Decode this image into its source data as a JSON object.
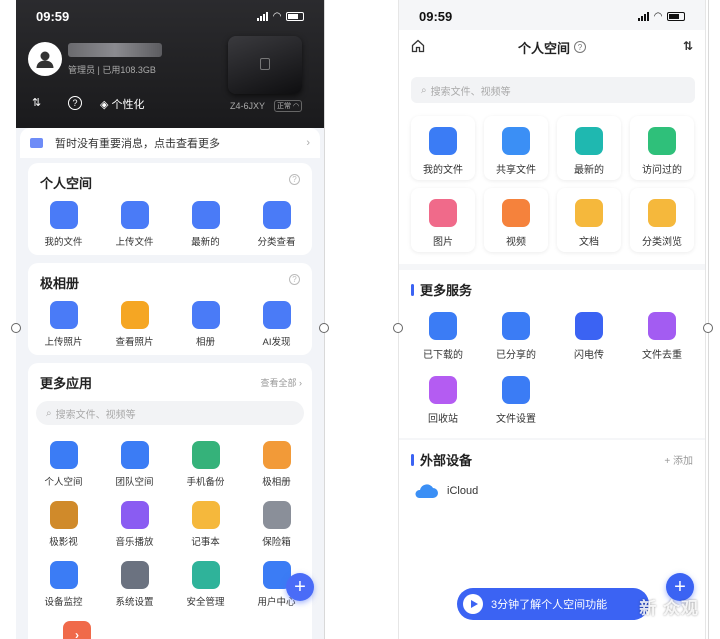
{
  "left": {
    "status": {
      "time": "09:59"
    },
    "header": {
      "role_storage": "管理员 | 已用108.3GB",
      "device_name": "Z4-6JXY",
      "device_status": "正常",
      "sort_icon_label": "⇅",
      "help_label": "?",
      "personalize_label": "个性化"
    },
    "notice": {
      "text": "暂时没有重要消息，点击查看更多",
      "chevron": "›"
    },
    "personal_space": {
      "title": "个人空间",
      "items": [
        {
          "label": "我的文件",
          "icon": "folder-person-icon",
          "color": "#4a7bf7"
        },
        {
          "label": "上传文件",
          "icon": "upload-icon",
          "color": "#4a7bf7"
        },
        {
          "label": "最新的",
          "icon": "bag-icon",
          "color": "#4a7bf7"
        },
        {
          "label": "分类查看",
          "icon": "pie-icon",
          "color": "#4a7bf7"
        }
      ]
    },
    "album": {
      "title": "极相册",
      "items": [
        {
          "label": "上传照片",
          "icon": "upload-photo-icon",
          "color": "#4a7bf7"
        },
        {
          "label": "查看照片",
          "icon": "view-photo-icon",
          "color": "#f5a623"
        },
        {
          "label": "相册",
          "icon": "album-icon",
          "color": "#4a7bf7"
        },
        {
          "label": "AI发现",
          "icon": "ai-robot-icon",
          "color": "#4a7bf7"
        }
      ]
    },
    "more_apps": {
      "title": "更多应用",
      "see_all": "查看全部 ›",
      "search_placeholder": "搜索文件、视频等",
      "rows": [
        [
          {
            "label": "个人空间",
            "icon": "folder-icon",
            "color": "#3b7cf5"
          },
          {
            "label": "团队空间",
            "icon": "team-folder-icon",
            "color": "#3b7cf5"
          },
          {
            "label": "手机备份",
            "icon": "phone-backup-icon",
            "color": "#35b27a"
          },
          {
            "label": "极相册",
            "icon": "photo-album-icon",
            "color": "#f29a38"
          }
        ],
        [
          {
            "label": "极影视",
            "icon": "video-icon",
            "color": "#d08a2a"
          },
          {
            "label": "音乐播放",
            "icon": "music-icon",
            "color": "#8a5cf2"
          },
          {
            "label": "记事本",
            "icon": "notepad-icon",
            "color": "#f5b83c"
          },
          {
            "label": "保险箱",
            "icon": "safe-icon",
            "color": "#8a8f99"
          }
        ],
        [
          {
            "label": "设备监控",
            "icon": "monitor-chart-icon",
            "color": "#3b7cf5"
          },
          {
            "label": "系统设置",
            "icon": "settings-icon",
            "color": "#6b7280"
          },
          {
            "label": "安全管理",
            "icon": "shield-icon",
            "color": "#2fb39a"
          },
          {
            "label": "用户中心",
            "icon": "user-center-icon",
            "color": "#3b7cf5"
          }
        ]
      ]
    },
    "fab": "+"
  },
  "right": {
    "status": {
      "time": "09:59"
    },
    "nav": {
      "title": "个人空间",
      "help": "?",
      "sort": "⇅"
    },
    "search_placeholder": "搜索文件、视频等",
    "tiles": [
      {
        "label": "我的文件",
        "icon": "folder-icon",
        "color": "#3b7cf5"
      },
      {
        "label": "共享文件",
        "icon": "shared-folder-icon",
        "color": "#3b8ff5"
      },
      {
        "label": "最新的",
        "icon": "cloud-icon",
        "color": "#1fb8b0"
      },
      {
        "label": "访问过的",
        "icon": "clock-icon",
        "color": "#2fc07a"
      },
      {
        "label": "图片",
        "icon": "image-icon",
        "color": "#f06a8a"
      },
      {
        "label": "视频",
        "icon": "video-camera-icon",
        "color": "#f5823c"
      },
      {
        "label": "文档",
        "icon": "document-icon",
        "color": "#f5b83c"
      },
      {
        "label": "分类浏览",
        "icon": "category-icon",
        "color": "#f5b83c"
      }
    ],
    "more_services": {
      "title": "更多服务",
      "items": [
        {
          "label": "已下载的",
          "icon": "download-icon",
          "color": "#3b7cf5"
        },
        {
          "label": "已分享的",
          "icon": "share-icon",
          "color": "#3b7cf5"
        },
        {
          "label": "闪电传",
          "icon": "lightning-icon",
          "color": "#3b63f3"
        },
        {
          "label": "文件去重",
          "icon": "broom-icon",
          "color": "#a35cf2"
        },
        {
          "label": "回收站",
          "icon": "trash-icon",
          "color": "#b45cf2"
        },
        {
          "label": "文件设置",
          "icon": "file-settings-icon",
          "color": "#3b7cf5"
        }
      ]
    },
    "external": {
      "title": "外部设备",
      "add": "+ 添加",
      "items": [
        {
          "label": "iCloud",
          "icon": "icloud-icon",
          "color": "#3b8ff5"
        }
      ]
    },
    "banner": "3分钟了解个人空间功能",
    "watermark": "新 众观",
    "fab": "+"
  }
}
